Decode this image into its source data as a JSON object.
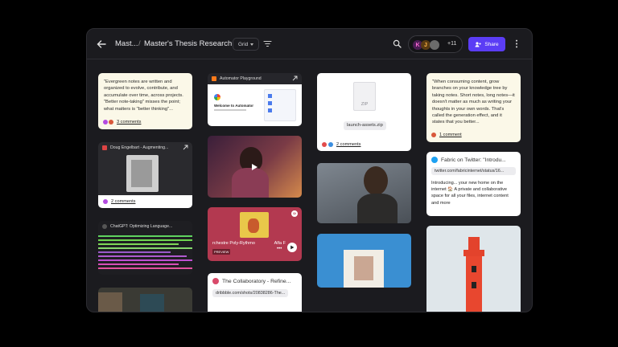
{
  "topbar": {
    "root": "Mast...",
    "separator": "/",
    "current": "Master's Thesis Research",
    "view": "Grid",
    "collaborator_initials": [
      "K",
      "J"
    ],
    "collaborator_count": "+11",
    "share_label": "Share"
  },
  "cards": {
    "note1": {
      "text": "\"Evergreen notes are written and organized to evolve, contribute, and accumulate over time, across projects. \"Better note-taking\" misses the point; what matters is \"better thinking\"...",
      "comments": "3 comments"
    },
    "automator": {
      "title": "Automator Playground",
      "welcome": "Welcome to Automator"
    },
    "zip": {
      "badge": "ZIP",
      "filename": "launch-assets.zip",
      "comments": "2 comments"
    },
    "note2": {
      "text": "\"When consuming content, grow branches on your knowledge tree by taking notes. Short notes, long notes—it doesn't matter as much as writing your thoughts in your own words. That's called the generation effect, and it states that you better...",
      "comments": "1 comment"
    },
    "engelbart": {
      "title": "Doug Engelbart - Augmenting...",
      "comments": "2 comments"
    },
    "fabric": {
      "title": "Fabric on Twitter: \"Introdu...",
      "url": "twitter.com/fabricinternet/status/16...",
      "body": "Introducing... your new home on the internet 🏠 A private and collaborative space for all your files, internet content and more"
    },
    "spotify": {
      "artist": "Alfa F",
      "track": "rchestre Poly-Rythmo",
      "tag": "PREVIEW"
    },
    "chatgpt": {
      "title": "ChatGPT: Optimizing Language..."
    },
    "collab": {
      "title": "The Collaboratory - Refine...",
      "url": "dribbble.com/shots/20838286-The..."
    }
  },
  "colors": {
    "accent": "#5b3df5",
    "note_bg": "#fbf8e8",
    "window_bg": "#1b1b1f"
  }
}
